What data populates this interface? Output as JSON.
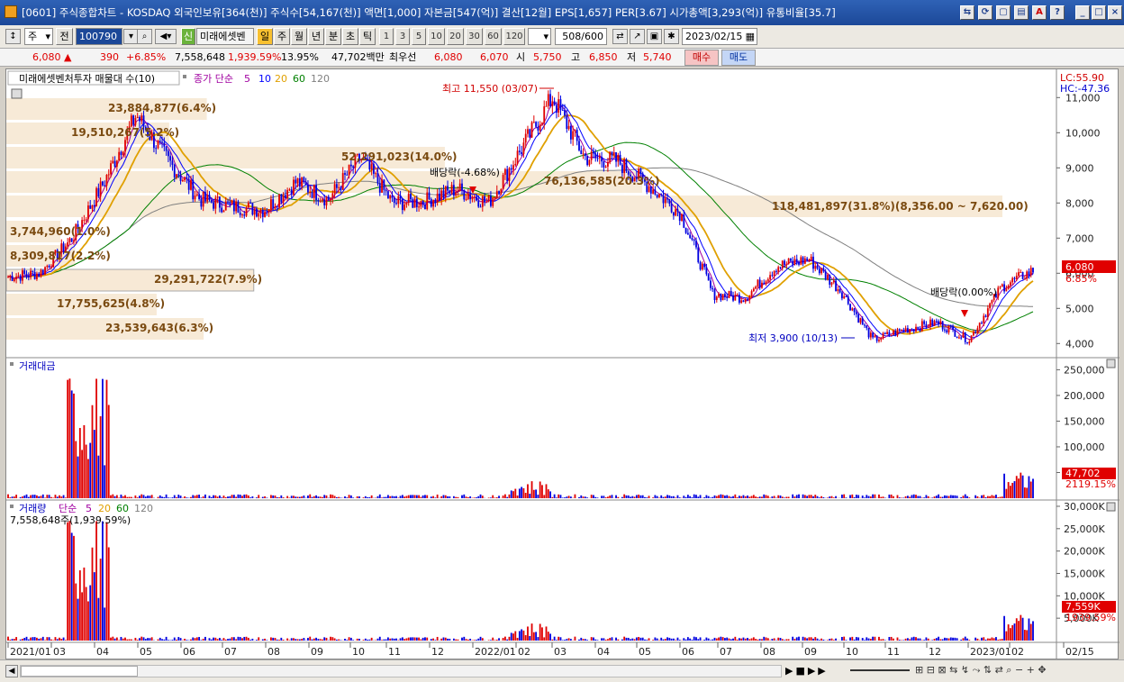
{
  "window": {
    "title": "[0601] 주식종합차트 - KOSDAQ 외국인보유[364(천)] 주식수[54,167(천)] 액면[1,000] 자본금[547(억)] 결산[12월] EPS[1,657] PER[3.67] 시가총액[3,293(억)] 유통비율[35.7]"
  },
  "toolbar": {
    "type_select": "주",
    "all_label": "전",
    "code": "100790",
    "stock_name": "미래에셋벤",
    "name_badge": "신",
    "periods": [
      "일",
      "주",
      "월",
      "년",
      "분",
      "초",
      "틱"
    ],
    "active_period": "일",
    "intervals": [
      "1",
      "3",
      "5",
      "10",
      "20",
      "30",
      "60",
      "120"
    ],
    "count": "508",
    "count_max": "/600",
    "date": "2023/02/15"
  },
  "quote": {
    "price": "6,080",
    "arrow": "▲",
    "change": "390",
    "change_pct": "+6.85%",
    "volume": "7,558,648",
    "volume_pct": "1,939.59%",
    "turnover": "13.95%",
    "amount": "47,702백만",
    "best_ask_label": "최우선",
    "best_ask": "6,080",
    "best_bid": "6,070",
    "open_label": "시",
    "open": "5,750",
    "high_label": "고",
    "high": "6,850",
    "low_label": "저",
    "low": "5,740",
    "buy_label": "매수",
    "sell_label": "매도"
  },
  "price_panel": {
    "legend_title": "미래에셋벤처투자 매물대 수(10)",
    "ma_label": "종가 단순",
    "ma_periods": [
      "5",
      "10",
      "20",
      "60",
      "120"
    ],
    "lc_label": "LC:55.90",
    "hc_label": "HC:-47.36",
    "current_price": "6,080",
    "current_pct": "6.85%",
    "high_annotation": "최고 11,550 (03/07)",
    "low_annotation": "최저 3,900 (10/13)",
    "dividend_1": "배당락(-4.68%)",
    "dividend_2": "배당락(0.00%)",
    "y_ticks": [
      "11,000",
      "10,000",
      "9,000",
      "8,000",
      "7,000",
      "6,000",
      "5,000",
      "4,000"
    ],
    "volume_profile": [
      "23,884,877(6.4%)",
      "19,510,267(5.2%)",
      "52,291,023(14.0%)",
      "76,136,585(20.3%)",
      "118,481,897(31.8%)(8,356.00 ~ 7,620.00)",
      "3,744,960(1.0%)",
      "8,309,817(2.2%)",
      "29,291,722(7.9%)",
      "17,755,625(4.8%)",
      "23,539,643(6.3%)"
    ]
  },
  "amount_panel": {
    "legend_title": "거래대금",
    "y_ticks": [
      "250,000",
      "200,000",
      "150,000",
      "100,000",
      "50,000"
    ],
    "current_value": "47,702",
    "current_pct": "2119.15%"
  },
  "volume_panel": {
    "legend_title": "거래량",
    "ma_label": "단순",
    "ma_periods": [
      "5",
      "20",
      "60",
      "120"
    ],
    "info": "7,558,648주(1,939.59%)",
    "y_ticks": [
      "30,000K",
      "25,000K",
      "20,000K",
      "15,000K",
      "10,000K",
      "5,000K"
    ],
    "current_value": "7,559K",
    "current_pct": "1939.59%"
  },
  "x_axis": {
    "labels": [
      "2021/01",
      "03",
      "04",
      "05",
      "06",
      "07",
      "08",
      "09",
      "10",
      "11",
      "12",
      "2022/01",
      "02",
      "03",
      "04",
      "05",
      "06",
      "07",
      "08",
      "09",
      "10",
      "11",
      "12",
      "2023/01",
      "02",
      "02/15"
    ]
  },
  "chart_data": {
    "type": "candlestick",
    "x_range": [
      "2021/01",
      "2023/02/15"
    ],
    "price_ylim": [
      3700,
      11700
    ],
    "price_close_series": [
      [
        "2021/01",
        5900
      ],
      [
        "2021/02",
        6000
      ],
      [
        "2021/03",
        7000
      ],
      [
        "2021/03b",
        8600
      ],
      [
        "2021/04",
        10500
      ],
      [
        "2021/04b",
        9200
      ],
      [
        "2021/05",
        8100
      ],
      [
        "2021/06",
        7900
      ],
      [
        "2021/07",
        7800
      ],
      [
        "2021/08",
        8600
      ],
      [
        "2021/08b",
        8100
      ],
      [
        "2021/09",
        9300
      ],
      [
        "2021/10",
        8000
      ],
      [
        "2021/11",
        8050
      ],
      [
        "2021/12",
        8400
      ],
      [
        "2022/01",
        8000
      ],
      [
        "2022/02",
        9500
      ],
      [
        "2022/03",
        11000
      ],
      [
        "2022/03b",
        9300
      ],
      [
        "2022/04",
        9200
      ],
      [
        "2022/05",
        8500
      ],
      [
        "2022/06",
        7700
      ],
      [
        "2022/06b",
        5400
      ],
      [
        "2022/07",
        5300
      ],
      [
        "2022/08",
        6200
      ],
      [
        "2022/08b",
        6400
      ],
      [
        "2022/09",
        5500
      ],
      [
        "2022/10",
        4100
      ],
      [
        "2022/11",
        4400
      ],
      [
        "2022/12",
        4600
      ],
      [
        "2023/01",
        4100
      ],
      [
        "2023/02",
        5600
      ],
      [
        "2023/02/15",
        6080
      ]
    ],
    "amount_ylim": [
      0,
      270000
    ],
    "volume_ylim": [
      0,
      31000
    ]
  }
}
